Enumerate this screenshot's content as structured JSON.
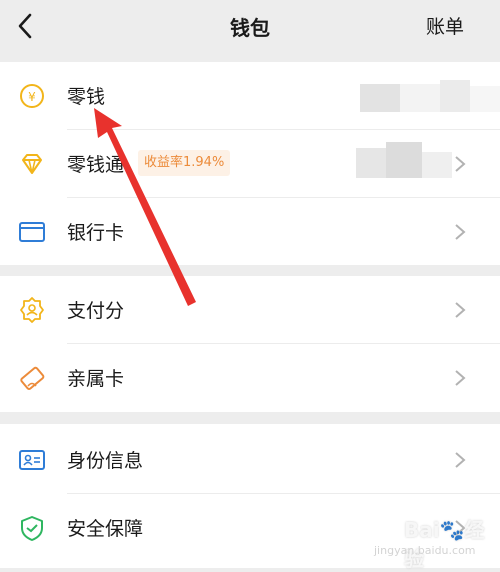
{
  "header": {
    "title": "钱包",
    "right_link": "账单"
  },
  "group1": {
    "items": [
      {
        "label": "零钱",
        "icon": "yuan-coin-icon"
      },
      {
        "label": "零钱通",
        "icon": "diamond-icon",
        "badge": "收益率1.94%"
      },
      {
        "label": "银行卡",
        "icon": "bank-card-icon"
      }
    ]
  },
  "group2": {
    "items": [
      {
        "label": "支付分",
        "icon": "pay-score-icon"
      },
      {
        "label": "亲属卡",
        "icon": "family-card-icon"
      }
    ]
  },
  "group3": {
    "items": [
      {
        "label": "身份信息",
        "icon": "id-card-icon"
      },
      {
        "label": "安全保障",
        "icon": "shield-icon"
      }
    ]
  },
  "watermark": {
    "brand": "Bai",
    "suffix": "经验",
    "url": "jingyan.baidu.com"
  },
  "colors": {
    "accent_yellow": "#f2b51a",
    "accent_blue": "#2f7dd7",
    "accent_orange": "#ec8b3a",
    "accent_green": "#2fb660",
    "arrow_red": "#e8322d",
    "page_bg": "#ededed"
  }
}
